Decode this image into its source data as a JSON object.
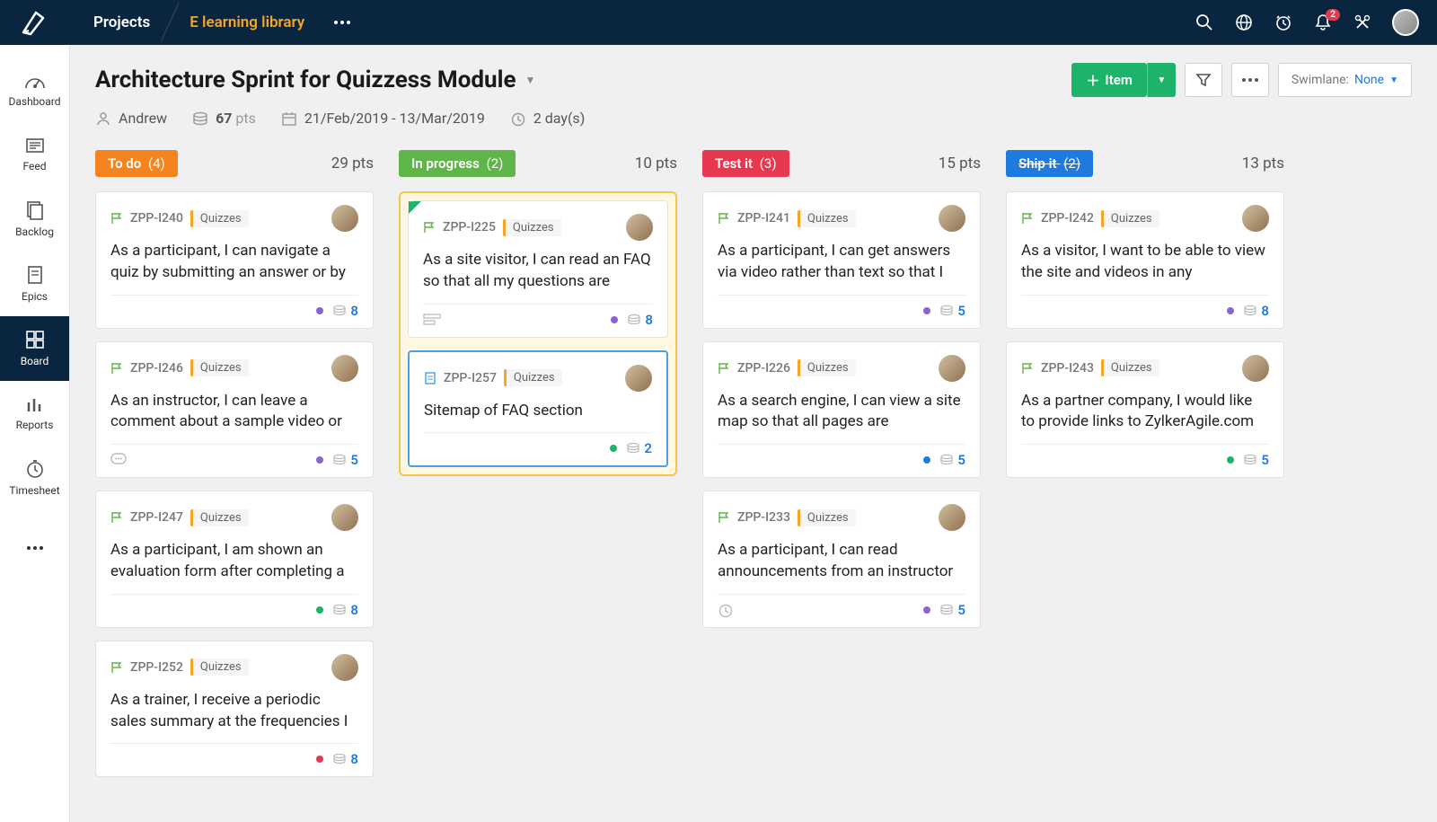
{
  "topnav": {
    "projects": "Projects",
    "library": "E learning library"
  },
  "notif_count": "2",
  "sidebar": {
    "dashboard": "Dashboard",
    "feed": "Feed",
    "backlog": "Backlog",
    "epics": "Epics",
    "board": "Board",
    "reports": "Reports",
    "timesheet": "Timesheet"
  },
  "sprint": {
    "title": "Architecture Sprint for Quizzess Module",
    "owner": "Andrew",
    "points": "67",
    "points_unit": "pts",
    "dates": "21/Feb/2019  -  13/Mar/2019",
    "duration": "2 day(s)"
  },
  "actions": {
    "add_item": "Item",
    "swimlane_label": "Swimlane:",
    "swimlane_value": "None"
  },
  "columns": [
    {
      "name": "To do",
      "count": "(4)",
      "pts": "29 pts",
      "color": "#f5841f",
      "hl": false,
      "cards": [
        {
          "id": "ZPP-I240",
          "tag": "Quizzes",
          "title": "As a participant, I can navigate a quiz by submitting an answer or by",
          "dot": "#8a63d2",
          "pts": "8",
          "flag": "green",
          "foot": "r"
        },
        {
          "id": "ZPP-I246",
          "tag": "Quizzes",
          "title": "As an instructor, I can leave a comment about a sample video or",
          "dot": "#8a63d2",
          "pts": "5",
          "flag": "green",
          "foot": "l",
          "licon": "comment"
        },
        {
          "id": "ZPP-I247",
          "tag": "Quizzes",
          "title": "As a participant, I am shown an evaluation form after completing a",
          "dot": "#1eb36a",
          "pts": "8",
          "flag": "green",
          "foot": "r"
        },
        {
          "id": "ZPP-I252",
          "tag": "Quizzes",
          "title": "As a trainer, I receive a periodic sales summary at the frequencies I",
          "dot": "#e8384f",
          "pts": "8",
          "flag": "green",
          "foot": "r"
        }
      ]
    },
    {
      "name": "In progress",
      "count": "(2)",
      "pts": "10 pts",
      "color": "#5fb548",
      "hl": true,
      "cards": [
        {
          "id": "ZPP-I225",
          "tag": "Quizzes",
          "title": "As a site visitor, I can read an FAQ so that all my questions are",
          "dot": "#8a63d2",
          "pts": "8",
          "flag": "green",
          "foot": "l",
          "licon": "sub",
          "corner": true
        },
        {
          "id": "ZPP-I257",
          "tag": "Quizzes",
          "title": "Sitemap of FAQ section",
          "dot": "#1eb36a",
          "pts": "2",
          "flag": "doc",
          "foot": "r",
          "sel": true
        }
      ]
    },
    {
      "name": "Test it",
      "count": "(3)",
      "pts": "15 pts",
      "color": "#e8384f",
      "hl": false,
      "cards": [
        {
          "id": "ZPP-I241",
          "tag": "Quizzes",
          "title": "As a participant, I can get answers via video rather than text so that I",
          "dot": "#8a63d2",
          "pts": "5",
          "flag": "green",
          "foot": "r"
        },
        {
          "id": "ZPP-I226",
          "tag": "Quizzes",
          "title": "As a search engine, I can view a site map so that all pages are",
          "dot": "#1f7ae0",
          "pts": "5",
          "flag": "green",
          "foot": "r"
        },
        {
          "id": "ZPP-I233",
          "tag": "Quizzes",
          "title": "As a participant, I can read announcements from an instructor",
          "dot": "#8a63d2",
          "pts": "5",
          "flag": "green",
          "foot": "l",
          "licon": "clock"
        }
      ]
    },
    {
      "name": "Ship it",
      "count": "(2)",
      "pts": "13 pts",
      "color": "#1f7ae0",
      "hl": false,
      "strike": true,
      "cards": [
        {
          "id": "ZPP-I242",
          "tag": "Quizzes",
          "title": "As a visitor, I want to be able to view the site and videos in any",
          "dot": "#8a63d2",
          "pts": "8",
          "flag": "green",
          "foot": "r"
        },
        {
          "id": "ZPP-I243",
          "tag": "Quizzes",
          "title": "As a partner company, I would like to provide links to ZylkerAgile.com",
          "dot": "#1eb36a",
          "pts": "5",
          "flag": "green",
          "foot": "r"
        }
      ]
    }
  ]
}
